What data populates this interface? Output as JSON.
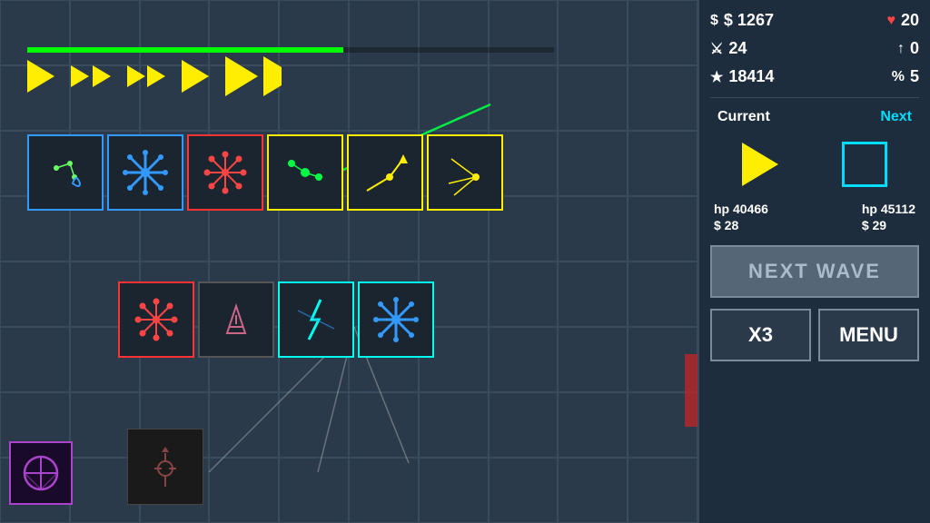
{
  "stats": {
    "money": "$ 1267",
    "health": "♥ 20",
    "sword": "24",
    "arrow": "0",
    "star": "18414",
    "percent": "% 5"
  },
  "labels": {
    "current": "Current",
    "next": "Next",
    "hp_current": "hp 40466",
    "price_current": "$ 28",
    "hp_next": "hp 45112",
    "price_next": "$ 29",
    "next_wave": "NEXT WAVE",
    "x3": "X3",
    "menu": "MENU"
  }
}
